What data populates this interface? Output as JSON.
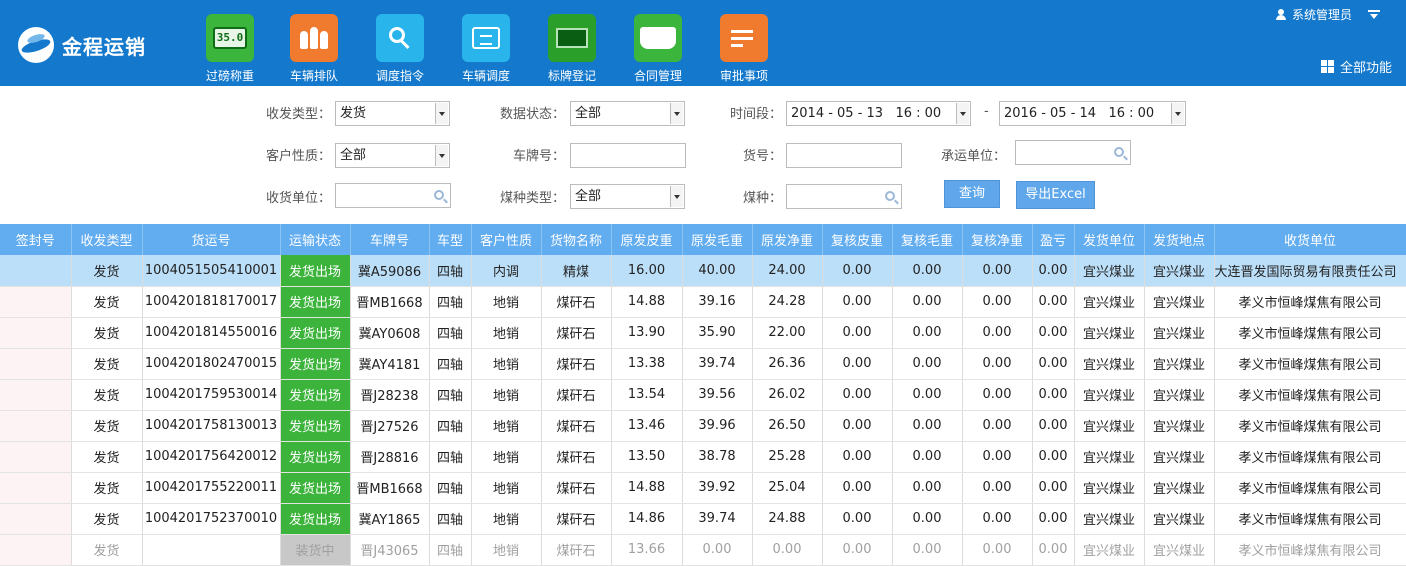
{
  "app": {
    "name": "金程运销"
  },
  "nav": [
    {
      "label": "过磅称重",
      "icon": "scale-icon",
      "color": "#3bb53b",
      "icon_text": "35.0"
    },
    {
      "label": "车辆排队",
      "icon": "queue-people-icon",
      "color": "#f07a2e"
    },
    {
      "label": "调度指令",
      "icon": "key-icon",
      "color": "#29b5ec"
    },
    {
      "label": "车辆调度",
      "icon": "truck-dispatch-icon",
      "color": "#29b5ec"
    },
    {
      "label": "标牌登记",
      "icon": "board-icon",
      "color": "#2a9f2a"
    },
    {
      "label": "合同管理",
      "icon": "folder-icon",
      "color": "#3bb53b"
    },
    {
      "label": "审批事项",
      "icon": "checklist-icon",
      "color": "#f07a2e"
    }
  ],
  "user": {
    "name": "系统管理员",
    "all_functions": "全部功能"
  },
  "filters": {
    "type_label": "收发类型：",
    "type_value": "发货",
    "data_status_label": "数据状态：",
    "data_status_value": "全部",
    "period_label": "时间段：",
    "period_start": "2014 - 05 - 13   16 : 00",
    "period_sep": "-",
    "period_end": "2016 - 05 - 14   16 : 00",
    "customer_type_label": "客户性质：",
    "customer_type_value": "全部",
    "plate_label": "车牌号：",
    "plate_value": "",
    "cargo_no_label": "货号：",
    "cargo_no_value": "",
    "carrier_label": "承运单位：",
    "carrier_value": "",
    "receiver_label": "收货单位：",
    "receiver_value": "",
    "coal_type_label": "煤种类型：",
    "coal_type_value": "全部",
    "coal_label": "煤种：",
    "coal_value": "",
    "query_button": "查询",
    "export_button": "导出Excel"
  },
  "table": {
    "columns": [
      "签封号",
      "收发类型",
      "货运号",
      "运输状态",
      "车牌号",
      "车型",
      "客户性质",
      "货物名称",
      "原发皮重",
      "原发毛重",
      "原发净重",
      "复核皮重",
      "复核毛重",
      "复核净重",
      "盈亏",
      "发货单位",
      "发货地点",
      "收货单位"
    ],
    "rows": [
      [
        "",
        "发货",
        "1004051505410001",
        "发货出场",
        "冀A59086",
        "四轴",
        "内调",
        "精煤",
        "16.00",
        "40.00",
        "24.00",
        "0.00",
        "0.00",
        "0.00",
        "0.00",
        "宜兴煤业",
        "宜兴煤业",
        "大连晋发国际贸易有限责任公司"
      ],
      [
        "",
        "发货",
        "1004201818170017",
        "发货出场",
        "晋MB1668",
        "四轴",
        "地销",
        "煤矸石",
        "14.88",
        "39.16",
        "24.28",
        "0.00",
        "0.00",
        "0.00",
        "0.00",
        "宜兴煤业",
        "宜兴煤业",
        "孝义市恒峰煤焦有限公司"
      ],
      [
        "",
        "发货",
        "1004201814550016",
        "发货出场",
        "冀AY0608",
        "四轴",
        "地销",
        "煤矸石",
        "13.90",
        "35.90",
        "22.00",
        "0.00",
        "0.00",
        "0.00",
        "0.00",
        "宜兴煤业",
        "宜兴煤业",
        "孝义市恒峰煤焦有限公司"
      ],
      [
        "",
        "发货",
        "1004201802470015",
        "发货出场",
        "冀AY4181",
        "四轴",
        "地销",
        "煤矸石",
        "13.38",
        "39.74",
        "26.36",
        "0.00",
        "0.00",
        "0.00",
        "0.00",
        "宜兴煤业",
        "宜兴煤业",
        "孝义市恒峰煤焦有限公司"
      ],
      [
        "",
        "发货",
        "1004201759530014",
        "发货出场",
        "晋J28238",
        "四轴",
        "地销",
        "煤矸石",
        "13.54",
        "39.56",
        "26.02",
        "0.00",
        "0.00",
        "0.00",
        "0.00",
        "宜兴煤业",
        "宜兴煤业",
        "孝义市恒峰煤焦有限公司"
      ],
      [
        "",
        "发货",
        "1004201758130013",
        "发货出场",
        "晋J27526",
        "四轴",
        "地销",
        "煤矸石",
        "13.46",
        "39.96",
        "26.50",
        "0.00",
        "0.00",
        "0.00",
        "0.00",
        "宜兴煤业",
        "宜兴煤业",
        "孝义市恒峰煤焦有限公司"
      ],
      [
        "",
        "发货",
        "1004201756420012",
        "发货出场",
        "晋J28816",
        "四轴",
        "地销",
        "煤矸石",
        "13.50",
        "38.78",
        "25.28",
        "0.00",
        "0.00",
        "0.00",
        "0.00",
        "宜兴煤业",
        "宜兴煤业",
        "孝义市恒峰煤焦有限公司"
      ],
      [
        "",
        "发货",
        "1004201755220011",
        "发货出场",
        "晋MB1668",
        "四轴",
        "地销",
        "煤矸石",
        "14.88",
        "39.92",
        "25.04",
        "0.00",
        "0.00",
        "0.00",
        "0.00",
        "宜兴煤业",
        "宜兴煤业",
        "孝义市恒峰煤焦有限公司"
      ],
      [
        "",
        "发货",
        "1004201752370010",
        "发货出场",
        "冀AY1865",
        "四轴",
        "地销",
        "煤矸石",
        "14.86",
        "39.74",
        "24.88",
        "0.00",
        "0.00",
        "0.00",
        "0.00",
        "宜兴煤业",
        "宜兴煤业",
        "孝义市恒峰煤焦有限公司"
      ],
      [
        "",
        "发货",
        "",
        "装货中",
        "晋J43065",
        "四轴",
        "地销",
        "煤矸石",
        "13.66",
        "0.00",
        "0.00",
        "0.00",
        "0.00",
        "0.00",
        "0.00",
        "宜兴煤业",
        "宜兴煤业",
        "孝义市恒峰煤焦有限公司"
      ]
    ],
    "status_done_color": "#3cb43c",
    "status_loading_color": "#c8c8c8"
  }
}
